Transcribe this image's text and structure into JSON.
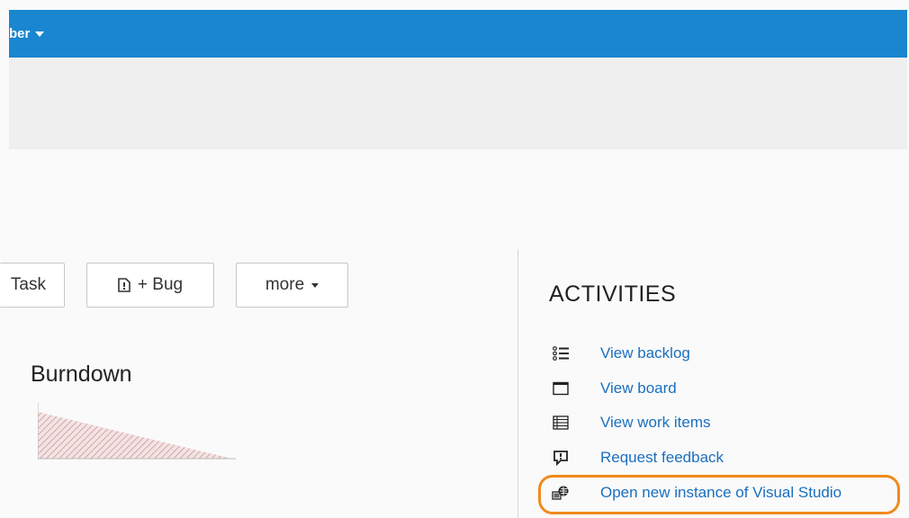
{
  "topbar": {
    "menu_label": "ber",
    "color": "#1a86cf"
  },
  "toolbar": {
    "task_label": "Task",
    "bug_label": "+ Bug",
    "more_label": "more"
  },
  "burndown": {
    "title": "Burndown"
  },
  "activities": {
    "title": "ACTIVITIES",
    "items": [
      {
        "label": "View backlog",
        "icon": "list-icon"
      },
      {
        "label": "View board",
        "icon": "board-icon"
      },
      {
        "label": "View work items",
        "icon": "table-icon"
      },
      {
        "label": "Request feedback",
        "icon": "feedback-icon"
      },
      {
        "label": "Open new instance of Visual Studio",
        "icon": "visual-studio-icon"
      }
    ]
  },
  "colors": {
    "link": "#1a6fbf",
    "highlight": "#f08a1d"
  }
}
